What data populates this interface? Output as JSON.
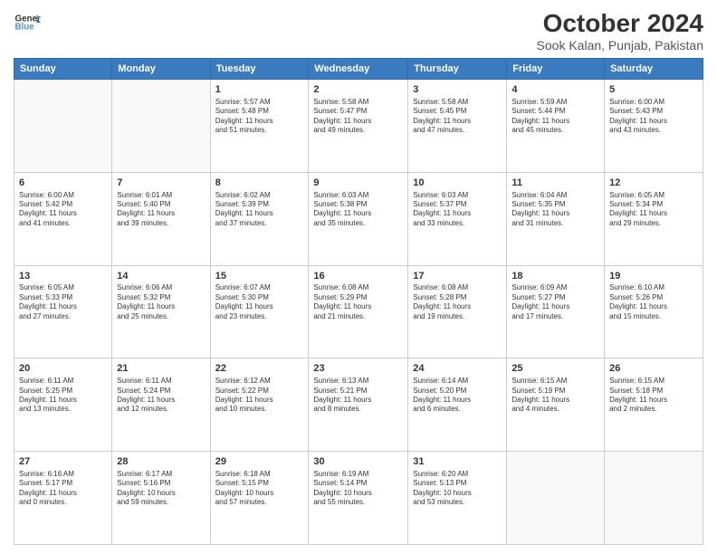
{
  "header": {
    "logo_line1": "General",
    "logo_line2": "Blue",
    "title": "October 2024",
    "subtitle": "Sook Kalan, Punjab, Pakistan"
  },
  "weekdays": [
    "Sunday",
    "Monday",
    "Tuesday",
    "Wednesday",
    "Thursday",
    "Friday",
    "Saturday"
  ],
  "weeks": [
    [
      {
        "day": "",
        "info": ""
      },
      {
        "day": "",
        "info": ""
      },
      {
        "day": "1",
        "info": "Sunrise: 5:57 AM\nSunset: 5:48 PM\nDaylight: 11 hours\nand 51 minutes."
      },
      {
        "day": "2",
        "info": "Sunrise: 5:58 AM\nSunset: 5:47 PM\nDaylight: 11 hours\nand 49 minutes."
      },
      {
        "day": "3",
        "info": "Sunrise: 5:58 AM\nSunset: 5:45 PM\nDaylight: 11 hours\nand 47 minutes."
      },
      {
        "day": "4",
        "info": "Sunrise: 5:59 AM\nSunset: 5:44 PM\nDaylight: 11 hours\nand 45 minutes."
      },
      {
        "day": "5",
        "info": "Sunrise: 6:00 AM\nSunset: 5:43 PM\nDaylight: 11 hours\nand 43 minutes."
      }
    ],
    [
      {
        "day": "6",
        "info": "Sunrise: 6:00 AM\nSunset: 5:42 PM\nDaylight: 11 hours\nand 41 minutes."
      },
      {
        "day": "7",
        "info": "Sunrise: 6:01 AM\nSunset: 5:40 PM\nDaylight: 11 hours\nand 39 minutes."
      },
      {
        "day": "8",
        "info": "Sunrise: 6:02 AM\nSunset: 5:39 PM\nDaylight: 11 hours\nand 37 minutes."
      },
      {
        "day": "9",
        "info": "Sunrise: 6:03 AM\nSunset: 5:38 PM\nDaylight: 11 hours\nand 35 minutes."
      },
      {
        "day": "10",
        "info": "Sunrise: 6:03 AM\nSunset: 5:37 PM\nDaylight: 11 hours\nand 33 minutes."
      },
      {
        "day": "11",
        "info": "Sunrise: 6:04 AM\nSunset: 5:35 PM\nDaylight: 11 hours\nand 31 minutes."
      },
      {
        "day": "12",
        "info": "Sunrise: 6:05 AM\nSunset: 5:34 PM\nDaylight: 11 hours\nand 29 minutes."
      }
    ],
    [
      {
        "day": "13",
        "info": "Sunrise: 6:05 AM\nSunset: 5:33 PM\nDaylight: 11 hours\nand 27 minutes."
      },
      {
        "day": "14",
        "info": "Sunrise: 6:06 AM\nSunset: 5:32 PM\nDaylight: 11 hours\nand 25 minutes."
      },
      {
        "day": "15",
        "info": "Sunrise: 6:07 AM\nSunset: 5:30 PM\nDaylight: 11 hours\nand 23 minutes."
      },
      {
        "day": "16",
        "info": "Sunrise: 6:08 AM\nSunset: 5:29 PM\nDaylight: 11 hours\nand 21 minutes."
      },
      {
        "day": "17",
        "info": "Sunrise: 6:08 AM\nSunset: 5:28 PM\nDaylight: 11 hours\nand 19 minutes."
      },
      {
        "day": "18",
        "info": "Sunrise: 6:09 AM\nSunset: 5:27 PM\nDaylight: 11 hours\nand 17 minutes."
      },
      {
        "day": "19",
        "info": "Sunrise: 6:10 AM\nSunset: 5:26 PM\nDaylight: 11 hours\nand 15 minutes."
      }
    ],
    [
      {
        "day": "20",
        "info": "Sunrise: 6:11 AM\nSunset: 5:25 PM\nDaylight: 11 hours\nand 13 minutes."
      },
      {
        "day": "21",
        "info": "Sunrise: 6:11 AM\nSunset: 5:24 PM\nDaylight: 11 hours\nand 12 minutes."
      },
      {
        "day": "22",
        "info": "Sunrise: 6:12 AM\nSunset: 5:22 PM\nDaylight: 11 hours\nand 10 minutes."
      },
      {
        "day": "23",
        "info": "Sunrise: 6:13 AM\nSunset: 5:21 PM\nDaylight: 11 hours\nand 8 minutes."
      },
      {
        "day": "24",
        "info": "Sunrise: 6:14 AM\nSunset: 5:20 PM\nDaylight: 11 hours\nand 6 minutes."
      },
      {
        "day": "25",
        "info": "Sunrise: 6:15 AM\nSunset: 5:19 PM\nDaylight: 11 hours\nand 4 minutes."
      },
      {
        "day": "26",
        "info": "Sunrise: 6:15 AM\nSunset: 5:18 PM\nDaylight: 11 hours\nand 2 minutes."
      }
    ],
    [
      {
        "day": "27",
        "info": "Sunrise: 6:16 AM\nSunset: 5:17 PM\nDaylight: 11 hours\nand 0 minutes."
      },
      {
        "day": "28",
        "info": "Sunrise: 6:17 AM\nSunset: 5:16 PM\nDaylight: 10 hours\nand 59 minutes."
      },
      {
        "day": "29",
        "info": "Sunrise: 6:18 AM\nSunset: 5:15 PM\nDaylight: 10 hours\nand 57 minutes."
      },
      {
        "day": "30",
        "info": "Sunrise: 6:19 AM\nSunset: 5:14 PM\nDaylight: 10 hours\nand 55 minutes."
      },
      {
        "day": "31",
        "info": "Sunrise: 6:20 AM\nSunset: 5:13 PM\nDaylight: 10 hours\nand 53 minutes."
      },
      {
        "day": "",
        "info": ""
      },
      {
        "day": "",
        "info": ""
      }
    ]
  ]
}
